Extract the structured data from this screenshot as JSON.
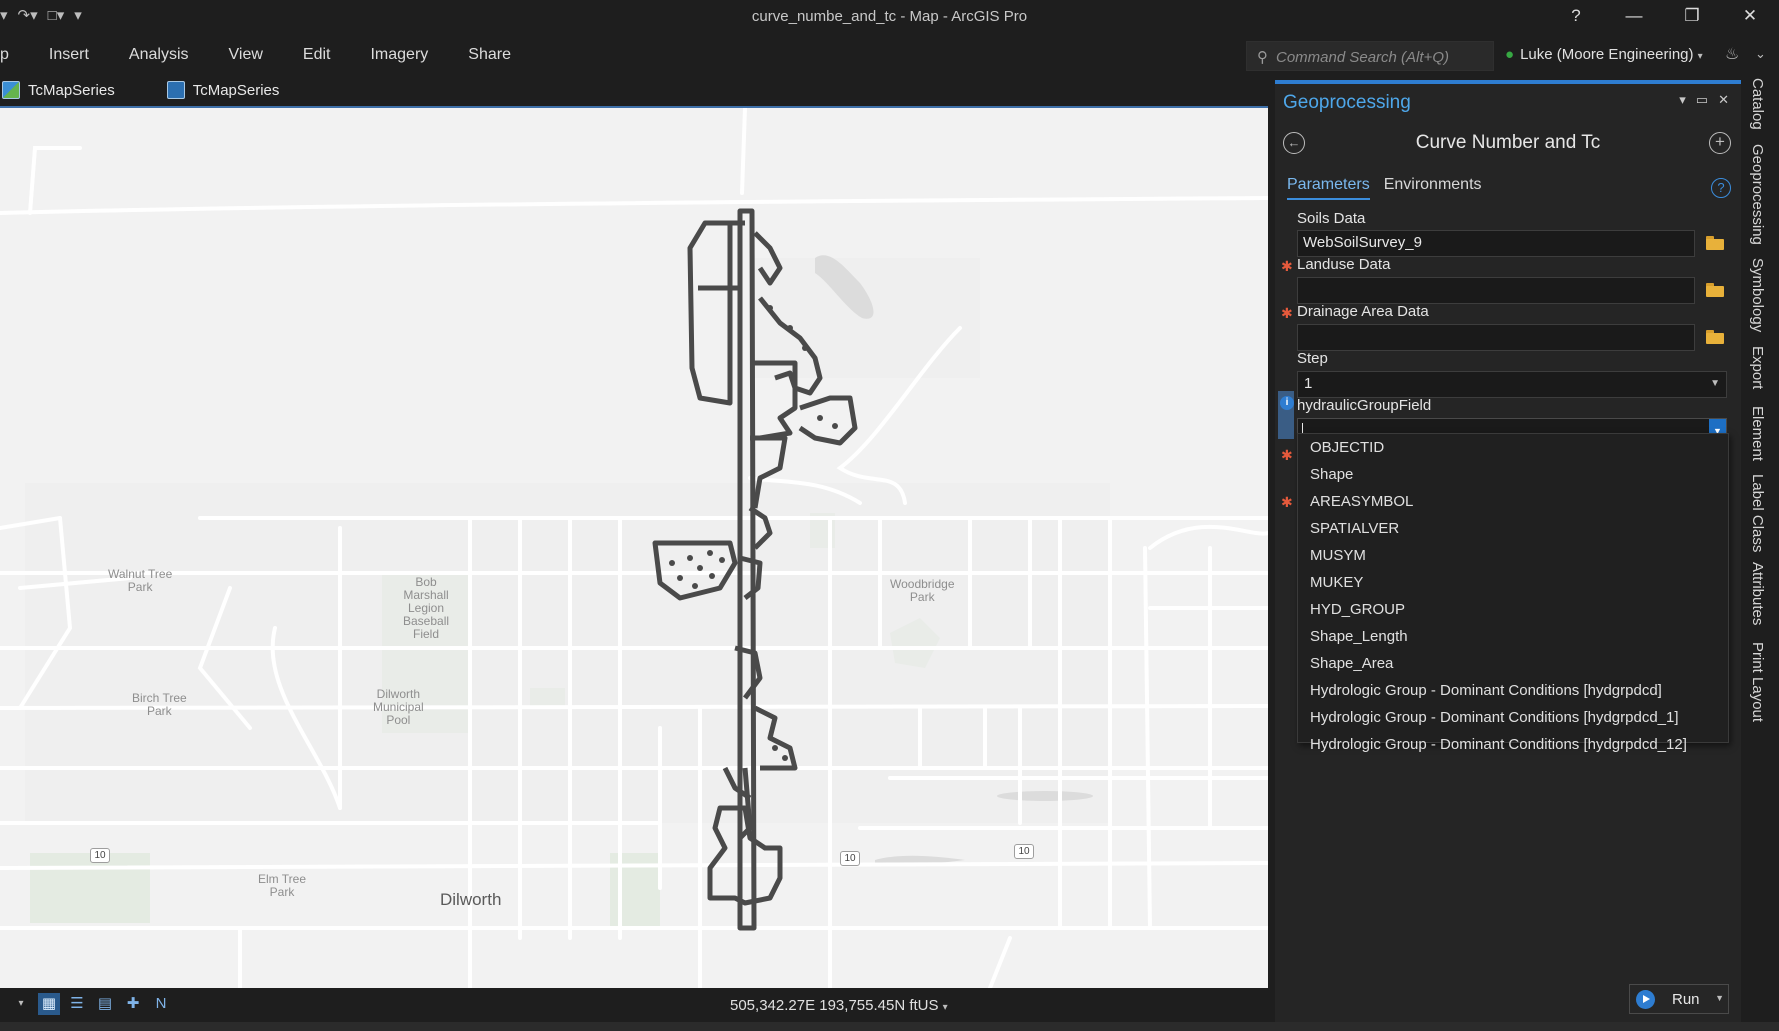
{
  "app": {
    "window_title": "curve_numbe_and_tc - Map - ArcGIS Pro",
    "help": "?",
    "minimize": "—",
    "restore": "❐",
    "close": "✕"
  },
  "ribbon": {
    "tabs": [
      "p",
      "Insert",
      "Analysis",
      "View",
      "Edit",
      "Imagery",
      "Share"
    ],
    "command_search_placeholder": "Command Search (Alt+Q)",
    "user": "Luke (Moore Engineering)"
  },
  "view_tabs": [
    {
      "label": "TcMapSeries",
      "icon": "map-icon"
    },
    {
      "label": "TcMapSeries",
      "icon": "layout-icon"
    }
  ],
  "map": {
    "place_labels": [
      {
        "name": "walnut",
        "text": [
          "Walnut Tree",
          "Park"
        ]
      },
      {
        "name": "bob",
        "text": [
          "Bob",
          "Marshall",
          "Legion",
          "Baseball",
          "Field"
        ]
      },
      {
        "name": "woodbridge",
        "text": [
          "Woodbridge",
          "Park"
        ]
      },
      {
        "name": "birch",
        "text": [
          "Birch Tree",
          "Park"
        ]
      },
      {
        "name": "pool",
        "text": [
          "Dilworth",
          "Municipal",
          "Pool"
        ]
      },
      {
        "name": "elm",
        "text": [
          "Elm Tree",
          "Park"
        ]
      }
    ],
    "city_label": "Dilworth",
    "highway_shields": [
      "10",
      "10",
      "10"
    ]
  },
  "statusbar": {
    "coordinates": "505,342.27E 193,755.45N ftUS"
  },
  "geoprocessing": {
    "pane_title": "Geoprocessing",
    "tool_title": "Curve Number and Tc",
    "tabs": [
      "Parameters",
      "Environments"
    ],
    "active_tab": "Parameters",
    "params": {
      "soils": {
        "label": "Soils Data",
        "value": "WebSoilSurvey_9",
        "required": false
      },
      "landuse": {
        "label": "Landuse Data",
        "value": "",
        "required": true
      },
      "drainage": {
        "label": "Drainage Area Data",
        "value": "",
        "required": true
      },
      "step": {
        "label": "Step",
        "value": "1"
      },
      "hydro": {
        "label": "hydraulicGroupField",
        "value": ""
      }
    },
    "dropdown_options": [
      "OBJECTID",
      "Shape",
      "AREASYMBOL",
      "SPATIALVER",
      "MUSYM",
      "MUKEY",
      "HYD_GROUP",
      "Shape_Length",
      "Shape_Area",
      "Hydrologic Group - Dominant Conditions [hydgrpdcd]",
      "Hydrologic Group - Dominant Conditions [hydgrpdcd_1]",
      "Hydrologic Group - Dominant Conditions [hydgrpdcd_12]"
    ],
    "run_label": "Run"
  },
  "side_tabs": [
    "Catalog",
    "Geoprocessing",
    "Symbology",
    "Export",
    "Element",
    "Label Class",
    "Attributes",
    "Print Layout"
  ],
  "colors": {
    "accent": "#2e7dd1",
    "pane_title": "#4ea7ea",
    "required_star": "#e55a3c",
    "folder": "#e8b13a"
  }
}
